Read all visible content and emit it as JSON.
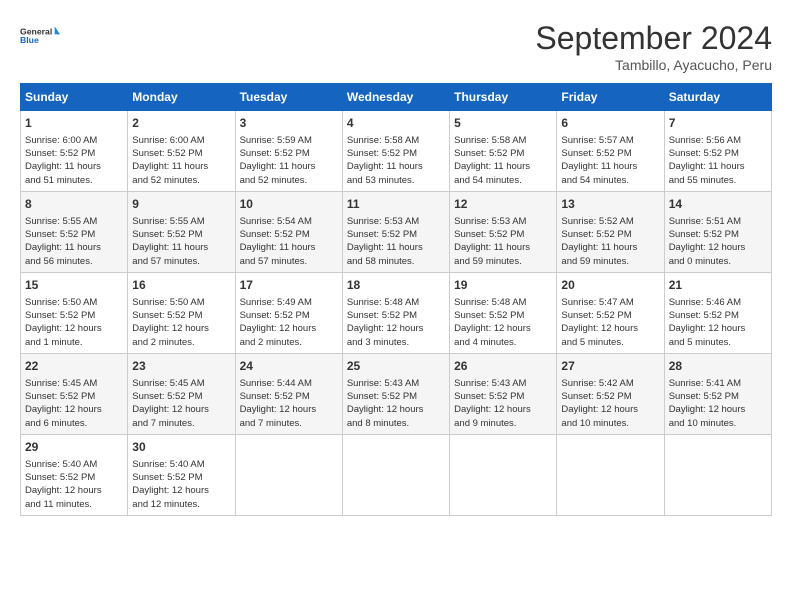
{
  "header": {
    "logo_line1": "General",
    "logo_line2": "Blue",
    "month": "September 2024",
    "location": "Tambillo, Ayacucho, Peru"
  },
  "weekdays": [
    "Sunday",
    "Monday",
    "Tuesday",
    "Wednesday",
    "Thursday",
    "Friday",
    "Saturday"
  ],
  "weeks": [
    [
      {
        "day": "1",
        "info": "Sunrise: 6:00 AM\nSunset: 5:52 PM\nDaylight: 11 hours\nand 51 minutes."
      },
      {
        "day": "2",
        "info": "Sunrise: 6:00 AM\nSunset: 5:52 PM\nDaylight: 11 hours\nand 52 minutes."
      },
      {
        "day": "3",
        "info": "Sunrise: 5:59 AM\nSunset: 5:52 PM\nDaylight: 11 hours\nand 52 minutes."
      },
      {
        "day": "4",
        "info": "Sunrise: 5:58 AM\nSunset: 5:52 PM\nDaylight: 11 hours\nand 53 minutes."
      },
      {
        "day": "5",
        "info": "Sunrise: 5:58 AM\nSunset: 5:52 PM\nDaylight: 11 hours\nand 54 minutes."
      },
      {
        "day": "6",
        "info": "Sunrise: 5:57 AM\nSunset: 5:52 PM\nDaylight: 11 hours\nand 54 minutes."
      },
      {
        "day": "7",
        "info": "Sunrise: 5:56 AM\nSunset: 5:52 PM\nDaylight: 11 hours\nand 55 minutes."
      }
    ],
    [
      {
        "day": "8",
        "info": "Sunrise: 5:55 AM\nSunset: 5:52 PM\nDaylight: 11 hours\nand 56 minutes."
      },
      {
        "day": "9",
        "info": "Sunrise: 5:55 AM\nSunset: 5:52 PM\nDaylight: 11 hours\nand 57 minutes."
      },
      {
        "day": "10",
        "info": "Sunrise: 5:54 AM\nSunset: 5:52 PM\nDaylight: 11 hours\nand 57 minutes."
      },
      {
        "day": "11",
        "info": "Sunrise: 5:53 AM\nSunset: 5:52 PM\nDaylight: 11 hours\nand 58 minutes."
      },
      {
        "day": "12",
        "info": "Sunrise: 5:53 AM\nSunset: 5:52 PM\nDaylight: 11 hours\nand 59 minutes."
      },
      {
        "day": "13",
        "info": "Sunrise: 5:52 AM\nSunset: 5:52 PM\nDaylight: 11 hours\nand 59 minutes."
      },
      {
        "day": "14",
        "info": "Sunrise: 5:51 AM\nSunset: 5:52 PM\nDaylight: 12 hours\nand 0 minutes."
      }
    ],
    [
      {
        "day": "15",
        "info": "Sunrise: 5:50 AM\nSunset: 5:52 PM\nDaylight: 12 hours\nand 1 minute."
      },
      {
        "day": "16",
        "info": "Sunrise: 5:50 AM\nSunset: 5:52 PM\nDaylight: 12 hours\nand 2 minutes."
      },
      {
        "day": "17",
        "info": "Sunrise: 5:49 AM\nSunset: 5:52 PM\nDaylight: 12 hours\nand 2 minutes."
      },
      {
        "day": "18",
        "info": "Sunrise: 5:48 AM\nSunset: 5:52 PM\nDaylight: 12 hours\nand 3 minutes."
      },
      {
        "day": "19",
        "info": "Sunrise: 5:48 AM\nSunset: 5:52 PM\nDaylight: 12 hours\nand 4 minutes."
      },
      {
        "day": "20",
        "info": "Sunrise: 5:47 AM\nSunset: 5:52 PM\nDaylight: 12 hours\nand 5 minutes."
      },
      {
        "day": "21",
        "info": "Sunrise: 5:46 AM\nSunset: 5:52 PM\nDaylight: 12 hours\nand 5 minutes."
      }
    ],
    [
      {
        "day": "22",
        "info": "Sunrise: 5:45 AM\nSunset: 5:52 PM\nDaylight: 12 hours\nand 6 minutes."
      },
      {
        "day": "23",
        "info": "Sunrise: 5:45 AM\nSunset: 5:52 PM\nDaylight: 12 hours\nand 7 minutes."
      },
      {
        "day": "24",
        "info": "Sunrise: 5:44 AM\nSunset: 5:52 PM\nDaylight: 12 hours\nand 7 minutes."
      },
      {
        "day": "25",
        "info": "Sunrise: 5:43 AM\nSunset: 5:52 PM\nDaylight: 12 hours\nand 8 minutes."
      },
      {
        "day": "26",
        "info": "Sunrise: 5:43 AM\nSunset: 5:52 PM\nDaylight: 12 hours\nand 9 minutes."
      },
      {
        "day": "27",
        "info": "Sunrise: 5:42 AM\nSunset: 5:52 PM\nDaylight: 12 hours\nand 10 minutes."
      },
      {
        "day": "28",
        "info": "Sunrise: 5:41 AM\nSunset: 5:52 PM\nDaylight: 12 hours\nand 10 minutes."
      }
    ],
    [
      {
        "day": "29",
        "info": "Sunrise: 5:40 AM\nSunset: 5:52 PM\nDaylight: 12 hours\nand 11 minutes."
      },
      {
        "day": "30",
        "info": "Sunrise: 5:40 AM\nSunset: 5:52 PM\nDaylight: 12 hours\nand 12 minutes."
      },
      {
        "day": "",
        "info": ""
      },
      {
        "day": "",
        "info": ""
      },
      {
        "day": "",
        "info": ""
      },
      {
        "day": "",
        "info": ""
      },
      {
        "day": "",
        "info": ""
      }
    ]
  ]
}
